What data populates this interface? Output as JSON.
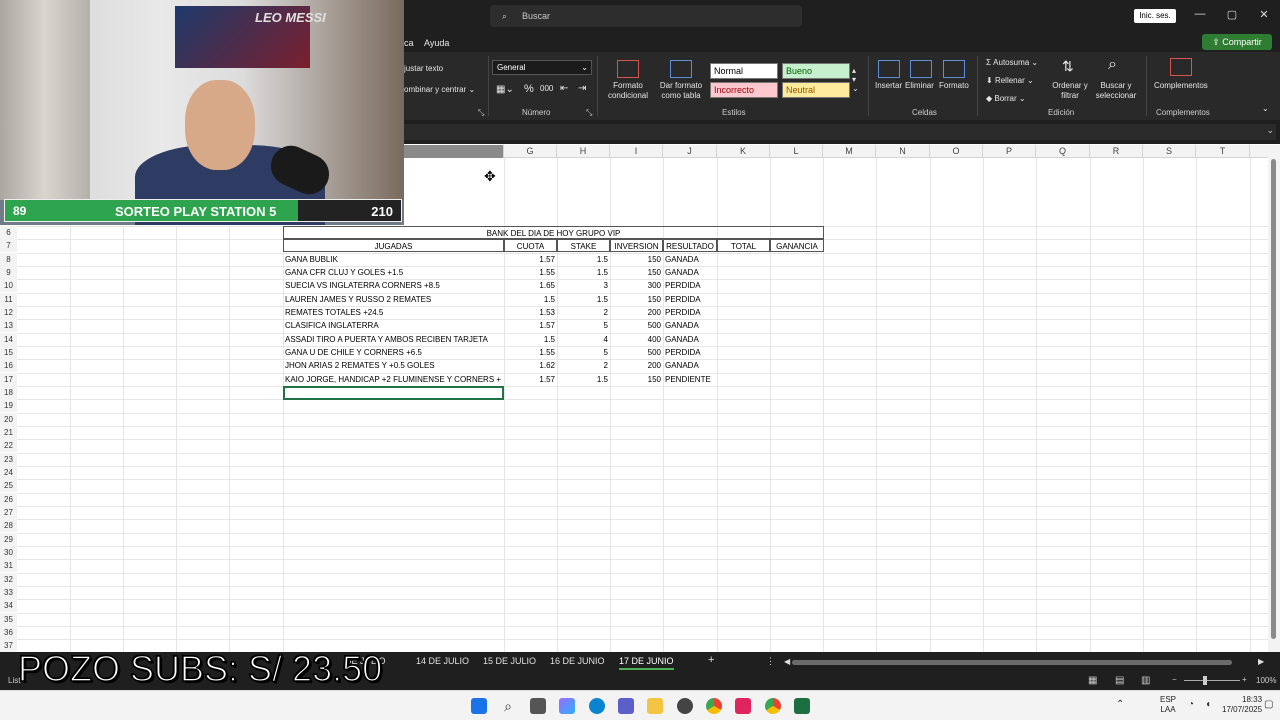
{
  "titlebar": {
    "search_placeholder": "Buscar",
    "signin": "Inic. ses.",
    "minimize": "—",
    "maximize": "▢",
    "close": "✕"
  },
  "menu": {
    "partial_tab": "ca",
    "help": "Ayuda",
    "share": "Compartir"
  },
  "ribbon": {
    "wrap_text": "justar texto",
    "merge_center": "ombinar y centrar",
    "number_format": "General",
    "number_group": "Número",
    "cond_format": "Formato condicional",
    "format_table": "Dar formato como tabla",
    "styles": {
      "normal": "Normal",
      "bueno": "Bueno",
      "incorrecto": "Incorrecto",
      "neutral": "Neutral"
    },
    "styles_group": "Estilos",
    "insert": "Insertar",
    "delete": "Eliminar",
    "format": "Formato",
    "cells_group": "Celdas",
    "autosum": "Autosuma",
    "fill": "Rellenar",
    "clear": "Borrar",
    "sort_filter": "Ordenar y filtrar",
    "find_select": "Buscar y seleccionar",
    "edit_group": "Edición",
    "addins": "Complementos",
    "addins_group": "Complementos",
    "colors": {
      "bueno_bg": "#c6efce",
      "bueno_fg": "#006100",
      "incorrecto_bg": "#ffc7ce",
      "incorrecto_fg": "#9c0006",
      "neutral_bg": "#ffeb9c",
      "neutral_fg": "#9c5700"
    }
  },
  "columns": [
    "G",
    "H",
    "I",
    "J",
    "K",
    "L",
    "M",
    "N",
    "O",
    "P",
    "Q",
    "R",
    "S",
    "T"
  ],
  "rows": [
    "6",
    "7",
    "8",
    "9",
    "10",
    "11",
    "12",
    "13",
    "14",
    "15",
    "16",
    "17",
    "18",
    "19",
    "20",
    "21",
    "22",
    "23",
    "24",
    "25",
    "26",
    "27",
    "28",
    "29",
    "30",
    "31",
    "32",
    "33",
    "34",
    "35",
    "36",
    "37"
  ],
  "table": {
    "title": "BANK DEL DIA DE HOY GRUPO VIP",
    "headers": [
      "JUGADAS",
      "CUOTA",
      "STAKE",
      "INVERSION",
      "RESULTADO",
      "TOTAL",
      "GANANCIA"
    ],
    "rows": [
      [
        "GANA BUBLIK",
        "1.57",
        "1.5",
        "150",
        "GANADA"
      ],
      [
        "GANA CFR CLUJ Y GOLES +1.5",
        "1.55",
        "1.5",
        "150",
        "GANADA"
      ],
      [
        "SUECIA VS INGLATERRA CORNERS +8.5",
        "1.65",
        "3",
        "300",
        "PERDIDA"
      ],
      [
        "LAUREN JAMES Y RUSSO 2 REMATES",
        "1.5",
        "1.5",
        "150",
        "PERDIDA"
      ],
      [
        "REMATES TOTALES +24.5",
        "1.53",
        "2",
        "200",
        "PERDIDA"
      ],
      [
        "CLASIFICA INGLATERRA",
        "1.57",
        "5",
        "500",
        "GANADA"
      ],
      [
        "ASSADI TIRO A PUERTA Y AMBOS RECIBEN TARJETA",
        "1.5",
        "4",
        "400",
        "GANADA"
      ],
      [
        "GANA U DE CHILE Y CORNERS +6.5",
        "1.55",
        "5",
        "500",
        "PERDIDA"
      ],
      [
        "JHON ARIAS 2 REMATES Y +0.5 GOLES",
        "1.62",
        "2",
        "200",
        "GANADA"
      ],
      [
        "KAIO JORGE, HANDICAP +2 FLUMINENSE Y CORNERS +",
        "1.57",
        "1.5",
        "150",
        "PENDIENTE"
      ]
    ]
  },
  "sheet_tabs": [
    "DE JULIO",
    "14 DE JULIO",
    "15 DE JULIO",
    "16 DE JUNIO",
    "17 DE JUNIO"
  ],
  "active_tab": "17 DE JUNIO",
  "status": {
    "ready": "List",
    "zoom": "100%"
  },
  "taskbar": {
    "lang1": "ESP",
    "lang2": "LAA",
    "time": "18:33",
    "date": "17/07/2025"
  },
  "overlay": {
    "poster_text": "LEO MESSI",
    "score_left": "89",
    "score_title": "SORTEO PLAY STATION 5",
    "score_right": "210",
    "pozo": "POZO SUBS: S/ 23.50"
  }
}
